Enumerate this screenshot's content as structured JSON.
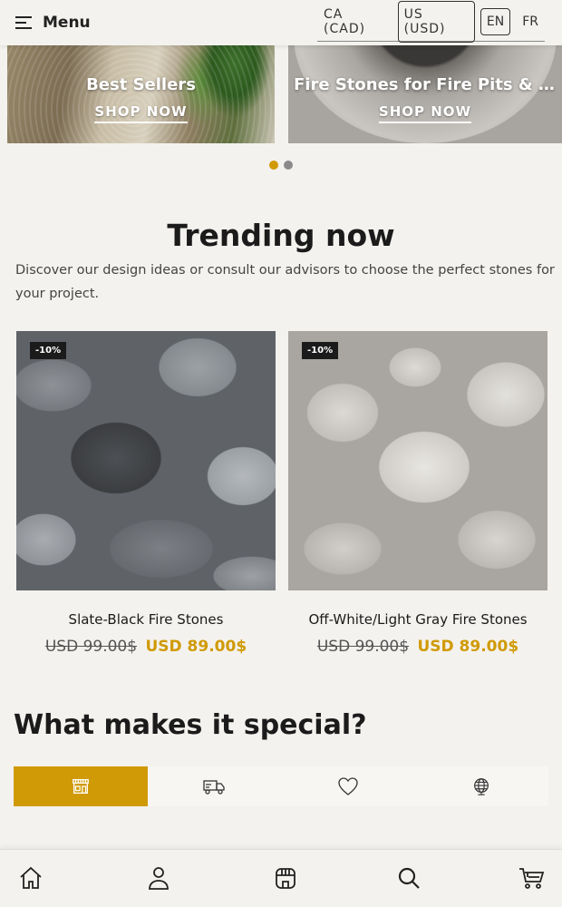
{
  "header": {
    "menu_label": "Menu",
    "currencies": [
      {
        "label": "CA (CAD)",
        "active": false
      },
      {
        "label": "US (USD)",
        "active": true
      }
    ],
    "languages": [
      {
        "label": "EN",
        "active": true
      },
      {
        "label": "FR",
        "active": false
      }
    ]
  },
  "carousel": {
    "slides": [
      {
        "title": "Best Sellers",
        "link": "SHOP NOW"
      },
      {
        "title": "Fire Stones for Fire Pits & Fire Bowls",
        "link": "SHOP NOW"
      }
    ],
    "active_dot": 0,
    "dot_count": 2
  },
  "trending": {
    "title": "Trending now",
    "description": "Discover our design ideas or consult our advisors to choose the perfect stones for your project.",
    "products": [
      {
        "badge": "-10%",
        "name": "Slate-Black Fire Stones",
        "old_price": "USD 99.00$",
        "price": "USD 89.00$"
      },
      {
        "badge": "-10%",
        "name": "Off-White/Light Gray Fire Stones",
        "old_price": "USD 99.00$",
        "price": "USD 89.00$"
      }
    ]
  },
  "special": {
    "title": "What makes it special?",
    "tabs": [
      {
        "icon": "store-icon",
        "active": true
      },
      {
        "icon": "truck-icon",
        "active": false
      },
      {
        "icon": "heart-icon",
        "active": false
      },
      {
        "icon": "globe-icon",
        "active": false
      }
    ]
  },
  "bottom_nav": [
    "home-icon",
    "account-icon",
    "store-icon",
    "search-icon",
    "cart-icon"
  ],
  "colors": {
    "accent": "#d09a06",
    "text": "#1b1b1b",
    "background": "#f4f2ee"
  }
}
